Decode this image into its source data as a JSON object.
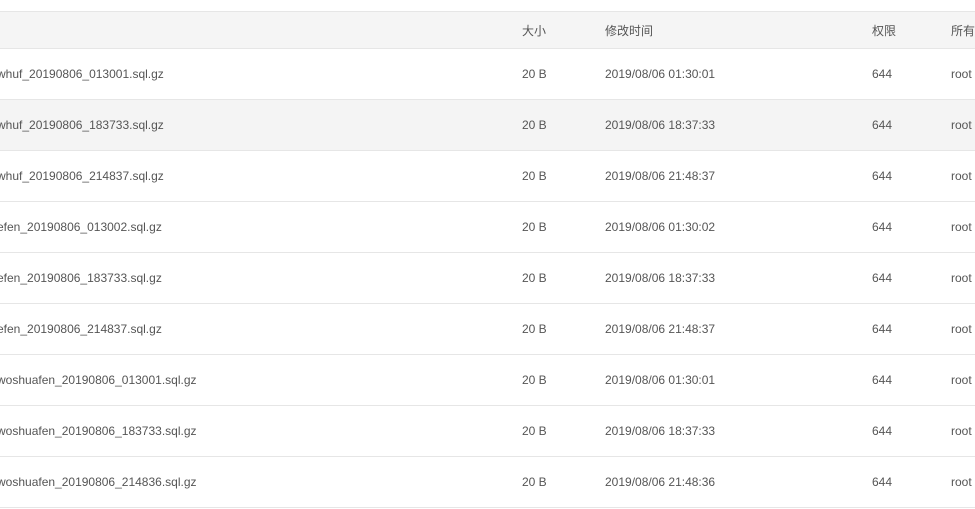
{
  "table": {
    "columns": {
      "size": "大小",
      "modified": "修改时间",
      "permission": "权限",
      "owner": "所有"
    },
    "rows": [
      {
        "name": "whuf_20190806_013001.sql.gz",
        "size": "20 B",
        "modified": "2019/08/06 01:30:01",
        "permission": "644",
        "owner": "root"
      },
      {
        "name": "whuf_20190806_183733.sql.gz",
        "size": "20 B",
        "modified": "2019/08/06 18:37:33",
        "permission": "644",
        "owner": "root"
      },
      {
        "name": "whuf_20190806_214837.sql.gz",
        "size": "20 B",
        "modified": "2019/08/06 21:48:37",
        "permission": "644",
        "owner": "root"
      },
      {
        "name": "efen_20190806_013002.sql.gz",
        "size": "20 B",
        "modified": "2019/08/06 01:30:02",
        "permission": "644",
        "owner": "root"
      },
      {
        "name": "efen_20190806_183733.sql.gz",
        "size": "20 B",
        "modified": "2019/08/06 18:37:33",
        "permission": "644",
        "owner": "root"
      },
      {
        "name": "efen_20190806_214837.sql.gz",
        "size": "20 B",
        "modified": "2019/08/06 21:48:37",
        "permission": "644",
        "owner": "root"
      },
      {
        "name": "woshuafen_20190806_013001.sql.gz",
        "size": "20 B",
        "modified": "2019/08/06 01:30:01",
        "permission": "644",
        "owner": "root"
      },
      {
        "name": "woshuafen_20190806_183733.sql.gz",
        "size": "20 B",
        "modified": "2019/08/06 18:37:33",
        "permission": "644",
        "owner": "root"
      },
      {
        "name": "woshuafen_20190806_214836.sql.gz",
        "size": "20 B",
        "modified": "2019/08/06 21:48:36",
        "permission": "644",
        "owner": "root"
      }
    ]
  }
}
